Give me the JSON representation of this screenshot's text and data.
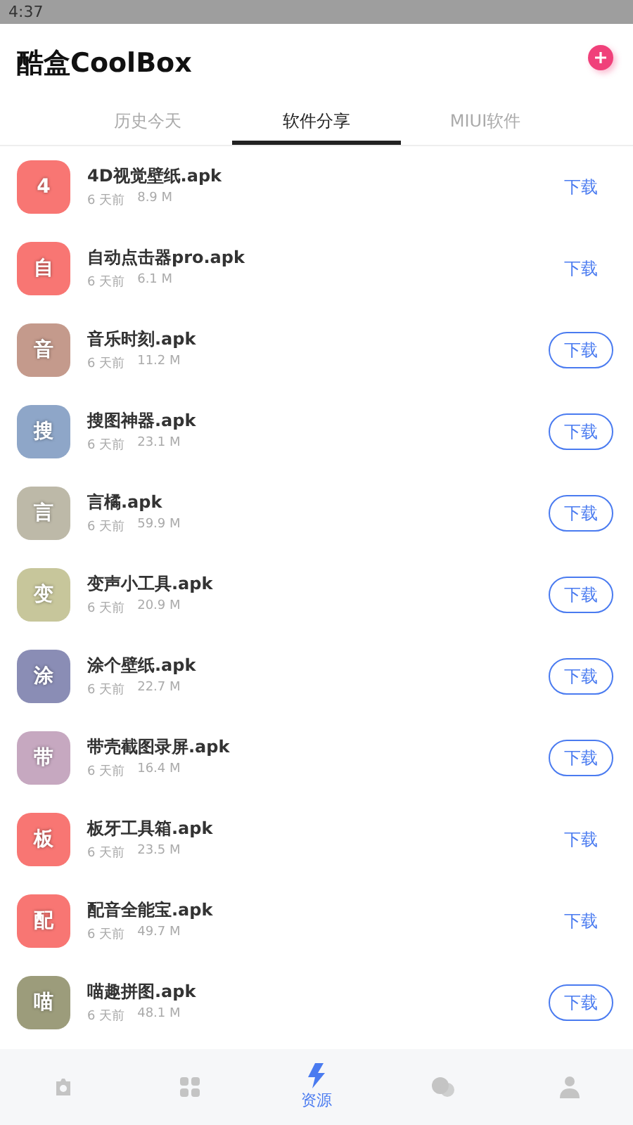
{
  "status_bar": {
    "time": "4:37"
  },
  "header": {
    "title": "酷盒CoolBox"
  },
  "tabs": [
    {
      "label": "历史今天",
      "selected": false
    },
    {
      "label": "软件分享",
      "selected": true
    },
    {
      "label": "MIUI软件",
      "selected": false
    }
  ],
  "apps": [
    {
      "glyph": "4",
      "name": "4D视觉壁纸.apk",
      "age": "6 天前",
      "size": "8.9 M",
      "color": "#f87673",
      "button": "下载",
      "outlined": false
    },
    {
      "glyph": "自",
      "name": "自动点击器pro.apk",
      "age": "6 天前",
      "size": "6.1 M",
      "color": "#f87673",
      "button": "下载",
      "outlined": false
    },
    {
      "glyph": "音",
      "name": "音乐时刻.apk",
      "age": "6 天前",
      "size": "11.2 M",
      "color": "#c49a8c",
      "button": "下载",
      "outlined": true
    },
    {
      "glyph": "搜",
      "name": "搜图神器.apk",
      "age": "6 天前",
      "size": "23.1 M",
      "color": "#8ea6c8",
      "button": "下载",
      "outlined": true
    },
    {
      "glyph": "言",
      "name": "言橘.apk",
      "age": "6 天前",
      "size": "59.9 M",
      "color": "#bdb9a8",
      "button": "下载",
      "outlined": true
    },
    {
      "glyph": "变",
      "name": "变声小工具.apk",
      "age": "6 天前",
      "size": "20.9 M",
      "color": "#c7c69b",
      "button": "下载",
      "outlined": true
    },
    {
      "glyph": "涂",
      "name": "涂个壁纸.apk",
      "age": "6 天前",
      "size": "22.7 M",
      "color": "#8a8db5",
      "button": "下载",
      "outlined": true
    },
    {
      "glyph": "带",
      "name": "带壳截图录屏.apk",
      "age": "6 天前",
      "size": "16.4 M",
      "color": "#c6a8c0",
      "button": "下载",
      "outlined": true
    },
    {
      "glyph": "板",
      "name": "板牙工具箱.apk",
      "age": "6 天前",
      "size": "23.5 M",
      "color": "#f87673",
      "button": "下载",
      "outlined": false
    },
    {
      "glyph": "配",
      "name": "配音全能宝.apk",
      "age": "6 天前",
      "size": "49.7 M",
      "color": "#f87673",
      "button": "下载",
      "outlined": false
    },
    {
      "glyph": "喵",
      "name": "喵趣拼图.apk",
      "age": "6 天前",
      "size": "48.1 M",
      "color": "#9c9c7b",
      "button": "下载",
      "outlined": true
    }
  ],
  "nav": [
    {
      "selected": false
    },
    {
      "selected": false
    },
    {
      "label": "资源",
      "selected": true
    },
    {
      "selected": false
    },
    {
      "selected": false
    }
  ]
}
